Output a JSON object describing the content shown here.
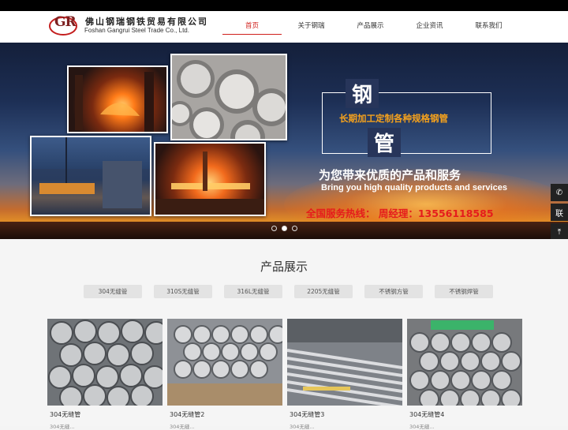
{
  "logo": {
    "mark": "GR",
    "name_cn": "佛山钢瑞钢铁贸易有限公司",
    "name_en": "Foshan Gangrui Steel Trade Co., Ltd."
  },
  "nav": {
    "items": [
      {
        "label": "首页",
        "active": true
      },
      {
        "label": "关于钢瑞",
        "active": false
      },
      {
        "label": "产品展示",
        "active": false
      },
      {
        "label": "企业资讯",
        "active": false
      },
      {
        "label": "联系我们",
        "active": false
      }
    ]
  },
  "banner": {
    "char1": "钢",
    "char2": "管",
    "tagline": "长期加工定制各种规格钢管",
    "slogan_cn": "为您带来优质的产品和服务",
    "slogan_en": "Bring you high quality products and services",
    "hotline": "全国服务热线： 周经理：13556118585",
    "slides": 3,
    "active_slide": 2
  },
  "side_tools": [
    {
      "icon": "phone-icon",
      "glyph": "✆"
    },
    {
      "icon": "contact-icon",
      "glyph": "联"
    },
    {
      "icon": "back-to-top-icon",
      "glyph": "⤒"
    }
  ],
  "products": {
    "title": "产品展示",
    "tabs": [
      "304无缝管",
      "310S无缝管",
      "316L无缝管",
      "2205无缝管",
      "不锈钢方管",
      "不锈钢焊管"
    ],
    "items": [
      {
        "name": "304无缝管",
        "sub": "304无缝..."
      },
      {
        "name": "304无缝管2",
        "sub": "304无缝..."
      },
      {
        "name": "304无缝管3",
        "sub": "304无缝..."
      },
      {
        "name": "304无缝管4",
        "sub": "304无缝..."
      }
    ]
  },
  "colors": {
    "accent": "#d0201c",
    "banner_orange": "#f6a21c",
    "hotline_red": "#e51c1c"
  }
}
